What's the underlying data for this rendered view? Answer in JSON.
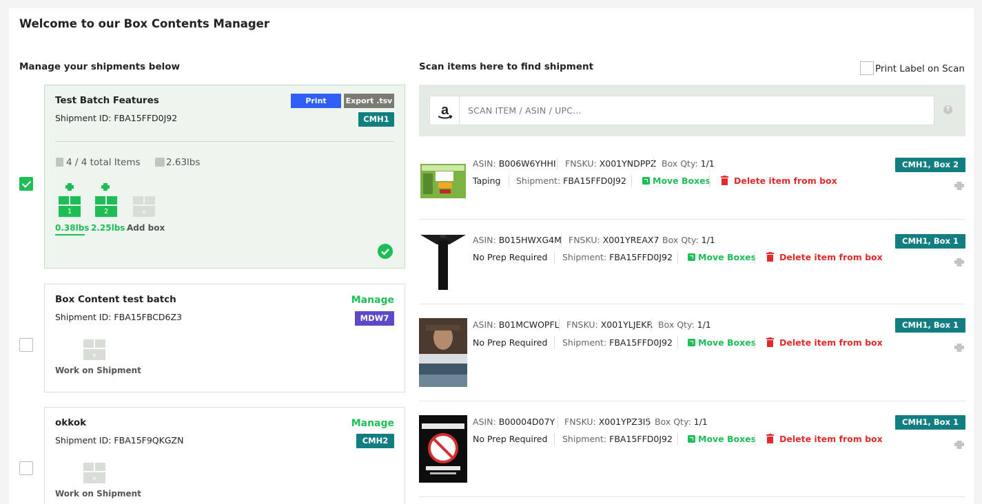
{
  "page": {
    "title": "Welcome to our Box Contents Manager",
    "left_heading": "Manage your shipments below",
    "right_heading": "Scan items here to find shipment",
    "print_on_scan_label": "Print Label on Scan"
  },
  "scan": {
    "placeholder": "SCAN ITEM / ASIN / UPC...",
    "help": "?"
  },
  "shipments": [
    {
      "name": "Test Batch Features",
      "shipment_id": "Shipment ID: FBA15FFD0J92",
      "print_label": "Print",
      "export_label": "Export .tsv",
      "center": "CMH1",
      "total_items": "4 / 4 total Items",
      "weight": "2.63lbs",
      "boxes": [
        {
          "number": "1",
          "weight": "0.38lbs"
        },
        {
          "number": "2",
          "weight": "2.25lbs"
        }
      ],
      "add_box_label": "Add box",
      "checked": true
    },
    {
      "name": "Box Content test batch",
      "shipment_id": "Shipment ID: FBA15FBCD6Z3",
      "manage_label": "Manage",
      "center": "MDW7",
      "work_label": "Work on Shipment",
      "checked": false
    },
    {
      "name": "okkok",
      "shipment_id": "Shipment ID: FBA15F9QKGZN",
      "manage_label": "Manage",
      "center": "CMH2",
      "work_label": "Work on Shipment",
      "checked": false
    }
  ],
  "items": [
    {
      "asin_key": "ASIN:",
      "asin": "B006W6YHHI",
      "fnsku_key": "FNSKU:",
      "fnsku": "X001YNDPPZ",
      "qty_key": "Box Qty:",
      "qty": "1/1",
      "prep": "Taping",
      "ship_key": "Shipment:",
      "shipment": "FBA15FFD0J92",
      "move": "Move Boxes",
      "delete": "Delete item from box",
      "location": "CMH1, Box 2"
    },
    {
      "asin_key": "ASIN:",
      "asin": "B015HWXG4M",
      "fnsku_key": "FNSKU:",
      "fnsku": "X001YREAX7",
      "qty_key": "Box Qty:",
      "qty": "1/1",
      "prep": "No Prep Required",
      "ship_key": "Shipment:",
      "shipment": "FBA15FFD0J92",
      "move": "Move Boxes",
      "delete": "Delete item from box",
      "location": "CMH1, Box 1"
    },
    {
      "asin_key": "ASIN:",
      "asin": "B01MCWOPFL",
      "fnsku_key": "FNSKU:",
      "fnsku": "X001YLJEKR",
      "qty_key": "Box Qty:",
      "qty": "1/1",
      "prep": "No Prep Required",
      "ship_key": "Shipment:",
      "shipment": "FBA15FFD0J92",
      "move": "Move Boxes",
      "delete": "Delete item from box",
      "location": "CMH1, Box 1"
    },
    {
      "asin_key": "ASIN:",
      "asin": "B00004D07Y",
      "fnsku_key": "FNSKU:",
      "fnsku": "X001YPZ3I5",
      "qty_key": "Box Qty:",
      "qty": "1/1",
      "prep": "No Prep Required",
      "ship_key": "Shipment:",
      "shipment": "FBA15FFD0J92",
      "move": "Move Boxes",
      "delete": "Delete item from box",
      "location": "CMH1, Box 1"
    }
  ],
  "colors": {
    "accent_green": "#1ebd56",
    "teal_badge": "#137e82",
    "purple_badge": "#5b49c9",
    "print_blue": "#2f5ff5",
    "export_grey": "#7a7a72",
    "delete_red": "#e02b2b"
  },
  "icons": [
    "clipboard-icon",
    "scale-icon",
    "printer-icon",
    "box-icon",
    "amazon-icon",
    "trash-icon",
    "external-link-icon",
    "checkmark-icon",
    "help-icon"
  ]
}
